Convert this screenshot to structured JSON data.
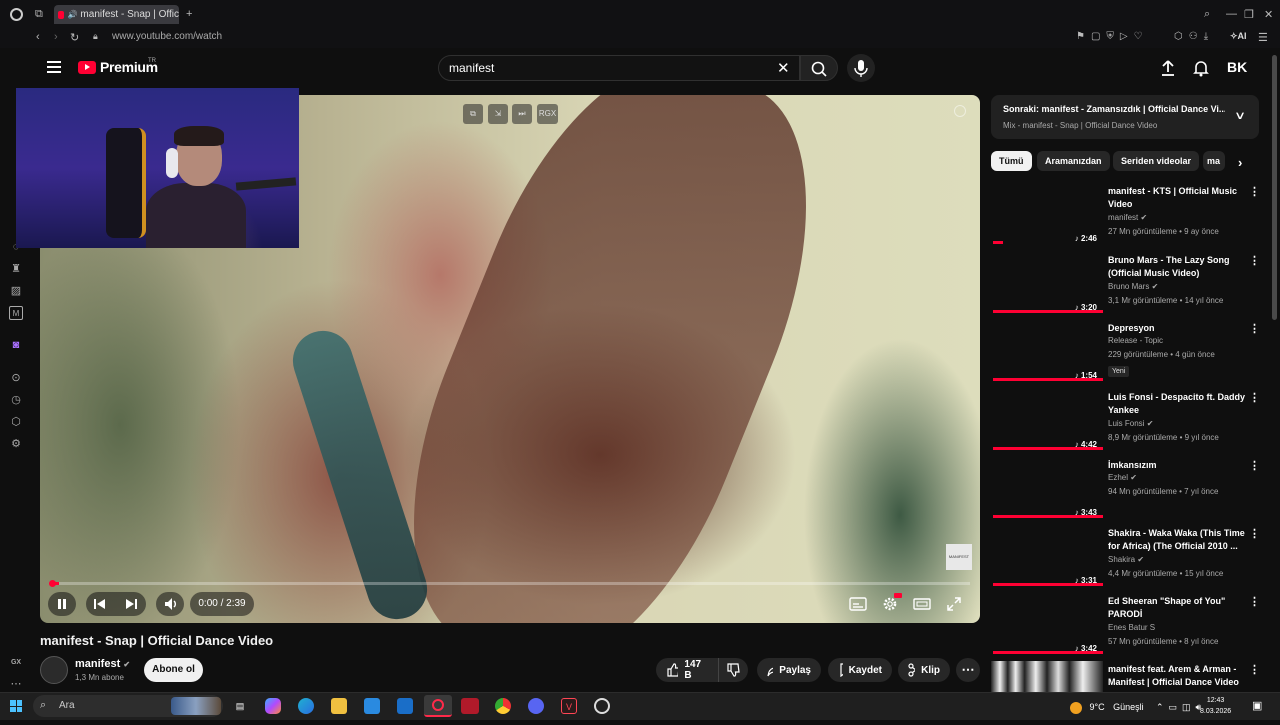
{
  "browser": {
    "tab_title": "manifest - Snap | Offic",
    "url": "www.youtube.com/watch",
    "ai_label": "AI",
    "gx_label": "GX"
  },
  "header": {
    "logo_text": "Premium",
    "logo_region": "TR",
    "search_value": "manifest",
    "avatar_initials": "BK"
  },
  "player": {
    "time": "0:00 / 2:39",
    "progress": 0.01,
    "speed_label": "RGX",
    "watermark": "MANIFEST"
  },
  "video": {
    "title": "manifest - Snap | Official Dance Video",
    "channel": "manifest",
    "subscribers": "1,3 Mn abone",
    "subscribe_label": "Abone ol",
    "likes": "147 B",
    "share_label": "Paylaş",
    "save_label": "Kaydet",
    "clip_label": "Klip"
  },
  "next": {
    "title": "Sonraki: manifest - Zamansızdık | Official Dance Vi...",
    "subtitle": "Mix - manifest - Snap | Official Dance Video"
  },
  "chips": [
    "Tümü",
    "Aramanızdan",
    "Seriden videolar",
    "ma"
  ],
  "recommendations": [
    {
      "title": "manifest - KTS | Official Music Video",
      "channel": "manifest",
      "meta": "27 Mn görüntüleme • 9 ay önce",
      "duration": "2:46",
      "verified": true
    },
    {
      "title": "Bruno Mars - The Lazy Song (Official Music Video)",
      "channel": "Bruno Mars",
      "meta": "3,1 Mr görüntüleme • 14 yıl önce",
      "duration": "3:20",
      "verified": true
    },
    {
      "title": "Depresyon",
      "channel": "Release - Topic",
      "meta": "229 görüntüleme • 4 gün önce",
      "duration": "1:54",
      "badge": "Yeni"
    },
    {
      "title": "Luis Fonsi - Despacito ft. Daddy Yankee",
      "channel": "Luis Fonsi",
      "meta": "8,9 Mr görüntüleme • 9 yıl önce",
      "duration": "4:42",
      "verified": true
    },
    {
      "title": "İmkansızım",
      "channel": "Ezhel",
      "meta": "94 Mn görüntüleme • 7 yıl önce",
      "duration": "3:43",
      "verified": true
    },
    {
      "title": "Shakira - Waka Waka (This Time for Africa) (The Official 2010 ...",
      "channel": "Shakira",
      "meta": "4,4 Mr görüntüleme • 15 yıl önce",
      "duration": "3:31",
      "verified": true
    },
    {
      "title": "Ed Sheeran \"Shape of You\" PARODİ",
      "channel": "Enes Batur S",
      "meta": "57 Mn görüntüleme • 8 yıl önce",
      "duration": "3:42"
    },
    {
      "title": "manifest feat. Arem & Arman - Manifest | Official Dance Video",
      "channel": "",
      "meta": "",
      "duration": ""
    }
  ],
  "taskbar": {
    "search_placeholder": "Ara",
    "weather": "9°C",
    "weather_desc": "Güneşli",
    "time": "12:43",
    "date": "8.03.2026"
  },
  "colors": {
    "accent": "#ff0033",
    "background": "#0f0f0f"
  }
}
